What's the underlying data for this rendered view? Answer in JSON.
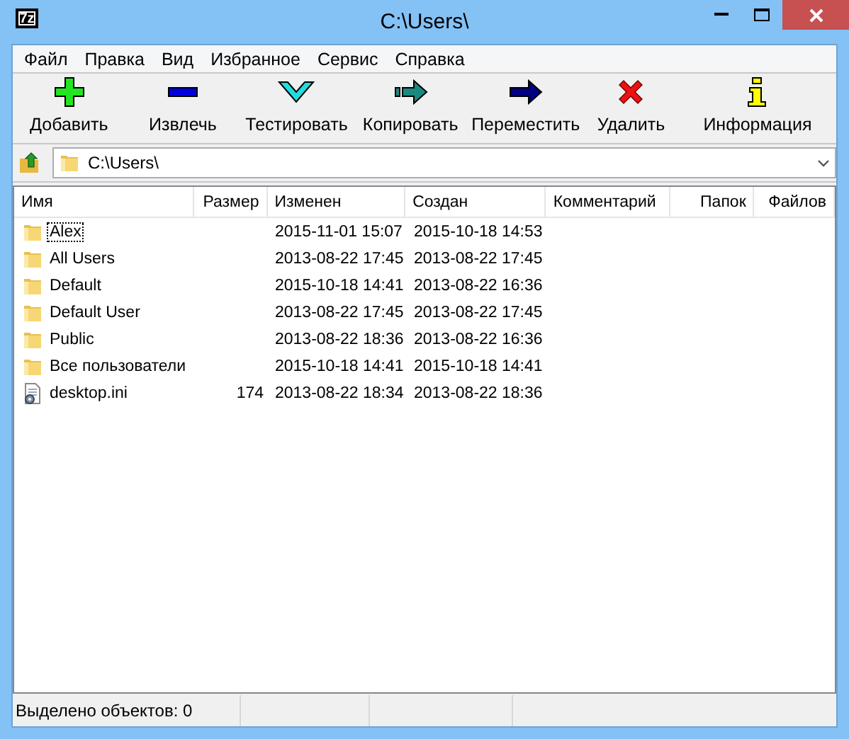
{
  "window": {
    "title": "C:\\Users\\",
    "app_icon": "7z"
  },
  "menu": [
    "Файл",
    "Правка",
    "Вид",
    "Избранное",
    "Сервис",
    "Справка"
  ],
  "toolbar": [
    {
      "label": "Добавить",
      "kind": "add"
    },
    {
      "label": "Извлечь",
      "kind": "extract"
    },
    {
      "label": "Тестировать",
      "kind": "test"
    },
    {
      "label": "Копировать",
      "kind": "copy"
    },
    {
      "label": "Переместить",
      "kind": "move"
    },
    {
      "label": "Удалить",
      "kind": "delete"
    },
    {
      "label": "Информация",
      "kind": "info"
    }
  ],
  "address": {
    "value": "C:\\Users\\"
  },
  "table": {
    "columns": [
      "Имя",
      "Размер",
      "Изменен",
      "Создан",
      "Комментарий",
      "Папок",
      "Файлов"
    ],
    "rows": [
      {
        "kind": "folder",
        "name": "Alex",
        "size": "",
        "modified": "2015-11-01 15:07",
        "created": "2015-10-18 14:53",
        "focused": true
      },
      {
        "kind": "folder",
        "name": "All Users",
        "size": "",
        "modified": "2013-08-22 17:45",
        "created": "2013-08-22 17:45",
        "focused": false
      },
      {
        "kind": "folder",
        "name": "Default",
        "size": "",
        "modified": "2015-10-18 14:41",
        "created": "2013-08-22 16:36",
        "focused": false
      },
      {
        "kind": "folder",
        "name": "Default User",
        "size": "",
        "modified": "2013-08-22 17:45",
        "created": "2013-08-22 17:45",
        "focused": false
      },
      {
        "kind": "folder",
        "name": "Public",
        "size": "",
        "modified": "2013-08-22 18:36",
        "created": "2013-08-22 16:36",
        "focused": false
      },
      {
        "kind": "folder",
        "name": "Все пользователи",
        "size": "",
        "modified": "2015-10-18 14:41",
        "created": "2015-10-18 14:41",
        "focused": false
      },
      {
        "kind": "file",
        "name": "desktop.ini",
        "size": "174",
        "modified": "2013-08-22 18:34",
        "created": "2013-08-22 18:36",
        "focused": false
      }
    ]
  },
  "status_bar": {
    "text": "Выделено объектов: 0"
  }
}
